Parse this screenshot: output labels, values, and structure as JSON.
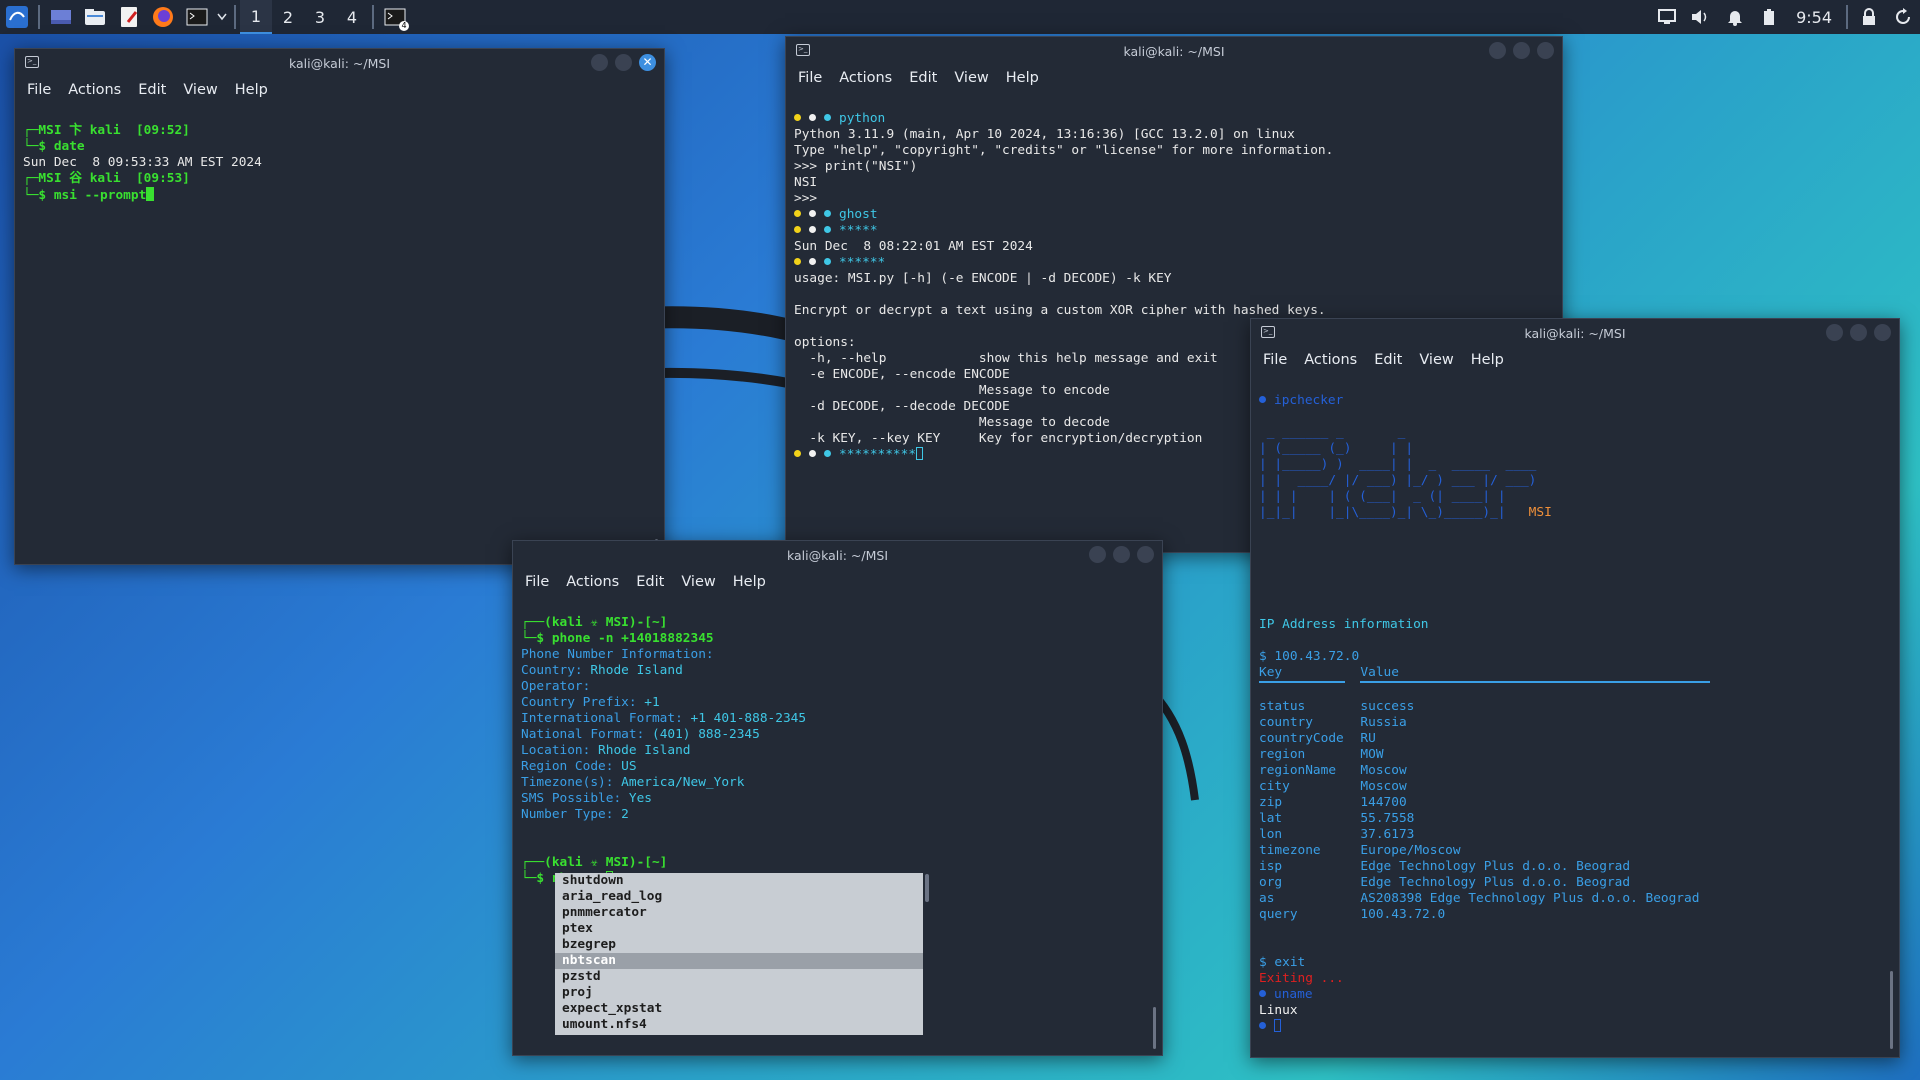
{
  "taskbar": {
    "workspaces": [
      "1",
      "2",
      "3",
      "4"
    ],
    "clock": "9:54",
    "badge": "4"
  },
  "win1": {
    "title": "kali@kali: ~/MSI",
    "menu": [
      "File",
      "Actions",
      "Edit",
      "View",
      "Help"
    ],
    "lines": {
      "p1": "┌─MSI 卞 kali  [09:52]",
      "c1": "└─$ date",
      "o1": "Sun Dec  8 09:53:33 AM EST 2024",
      "p2": "┌─MSI ⾕ kali  [09:53]",
      "c2": "└─$ msi --prompt"
    }
  },
  "win2": {
    "title": "kali@kali: ~/MSI",
    "menu": [
      "File",
      "Actions",
      "Edit",
      "View",
      "Help"
    ],
    "l_python": "python",
    "l1": "Python 3.11.9 (main, Apr 10 2024, 13:16:36) [GCC 13.2.0] on linux",
    "l2": "Type \"help\", \"copyright\", \"credits\" or \"license\" for more information.",
    "l3": ">>> print(\"NSI\")",
    "l4": "NSI",
    "l5": ">>>",
    "l_ghost": "ghost",
    "l_stars1": "*****",
    "l6": "Sun Dec  8 08:22:01 AM EST 2024",
    "l_stars2": "******",
    "l7": "usage: MSI.py [-h] (-e ENCODE | -d DECODE) -k KEY",
    "l8": "Encrypt or decrypt a text using a custom XOR cipher with hashed keys.",
    "l9": "options:",
    "l10": "  -h, --help            show this help message and exit",
    "l11": "  -e ENCODE, --encode ENCODE",
    "l12": "                        Message to encode",
    "l13": "  -d DECODE, --decode DECODE",
    "l14": "                        Message to decode",
    "l15": "  -k KEY, --key KEY     Key for encryption/decryption",
    "l_stars3": "**********"
  },
  "win3": {
    "title": "kali@kali: ~/MSI",
    "menu": [
      "File",
      "Actions",
      "Edit",
      "View",
      "Help"
    ],
    "prompt1": "┌──(kali ☣ MSI)-[~]",
    "cmd1": "└─$ phone -n +14018882345",
    "info_title": "Phone Number Information:",
    "rows": [
      {
        "k": "Country: ",
        "v": "Rhode Island"
      },
      {
        "k": "Operator: ",
        "v": ""
      },
      {
        "k": "Country Prefix: ",
        "v": "+1"
      },
      {
        "k": "International Format: ",
        "v": "+1 401-888-2345"
      },
      {
        "k": "National Format: ",
        "v": "(401) 888-2345"
      },
      {
        "k": "Location: ",
        "v": "Rhode Island"
      },
      {
        "k": "Region Code: ",
        "v": "US"
      },
      {
        "k": "Timezone(s): ",
        "v": "America/New_York"
      },
      {
        "k": "SMS Possible: ",
        "v": "Yes"
      },
      {
        "k": "Number Type: ",
        "v": "2"
      }
    ],
    "prompt2": "┌──(kali ☣ MSI)-[~]",
    "cmd2": "└─$ nbtscan",
    "completions": [
      "shutdown",
      "aria_read_log",
      "pnmmercator",
      "ptex",
      "bzegrep",
      "nbtscan",
      "pzstd",
      "proj",
      "expect_xpstat",
      "umount.nfs4"
    ],
    "selected": "nbtscan"
  },
  "win4": {
    "title": "kali@kali: ~/MSI",
    "menu": [
      "File",
      "Actions",
      "Edit",
      "View",
      "Help"
    ],
    "l_ipchecker": "ipchecker",
    "ascii": [
      " _ ______ _       _                        ",
      "| (_____ (_)     | |                       ",
      "| |_____) )  ____| |  _  _____  ____       ",
      "| |  ____/ |/ ___) |_/ ) ___ |/ ___)       ",
      "| | |    | ( (___|  _ (| ____| |           ",
      "|_|_|    |_|\\____)_| \\_)_____)_|   "
    ],
    "ascii_tag": "MSI",
    "ip_title": "IP Address information",
    "ip_cmd": "$ 100.43.72.0",
    "col_key": "Key",
    "col_value": "Value",
    "rows": [
      {
        "k": "status",
        "v": "success"
      },
      {
        "k": "country",
        "v": "Russia"
      },
      {
        "k": "countryCode",
        "v": "RU"
      },
      {
        "k": "region",
        "v": "MOW"
      },
      {
        "k": "regionName",
        "v": "Moscow"
      },
      {
        "k": "city",
        "v": "Moscow"
      },
      {
        "k": "zip",
        "v": "144700"
      },
      {
        "k": "lat",
        "v": "55.7558"
      },
      {
        "k": "lon",
        "v": "37.6173"
      },
      {
        "k": "timezone",
        "v": "Europe/Moscow"
      },
      {
        "k": "isp",
        "v": "Edge Technology Plus d.o.o. Beograd"
      },
      {
        "k": "org",
        "v": "Edge Technology Plus d.o.o. Beograd"
      },
      {
        "k": "as",
        "v": "AS208398 Edge Technology Plus d.o.o. Beograd"
      },
      {
        "k": "query",
        "v": "100.43.72.0"
      }
    ],
    "exit_cmd": "$ exit",
    "exiting": "Exiting ...",
    "l_uname": "uname",
    "linux": "Linux"
  },
  "colors": {
    "accent": "#3d8fe0",
    "green": "#39e030",
    "blue": "#3a9fe6",
    "cyan": "#3fc7e6"
  }
}
